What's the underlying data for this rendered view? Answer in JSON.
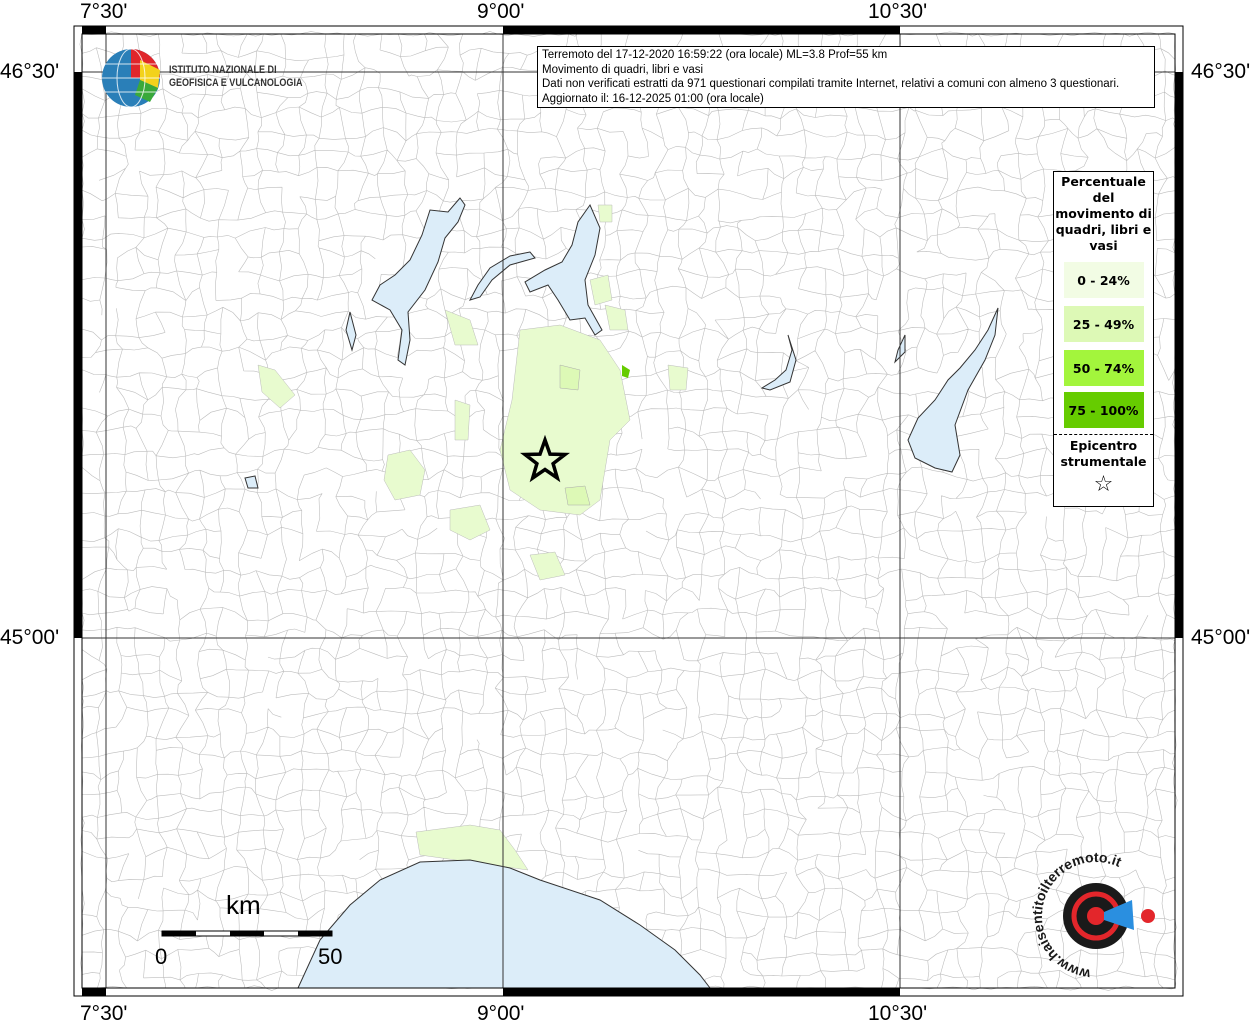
{
  "header": {
    "line1": "Terremoto del 17-12-2020 16:59:22 (ora locale) ML=3.8 Prof=55 km",
    "line2": "Movimento di quadri, libri e vasi",
    "line3": "Dati non verificati estratti da 971 questionari compilati tramite Internet, relativi a comuni con almeno 3 questionari.",
    "line4": "Aggiornato il: 16-12-2025 01:00 (ora locale)"
  },
  "axes": {
    "top": [
      "7°30'",
      "9°00'",
      "10°30'"
    ],
    "bottom": [
      "7°30'",
      "9°00'",
      "10°30'"
    ],
    "left": [
      "46°30'",
      "45°00'"
    ],
    "right": [
      "46°30'",
      "45°00'"
    ]
  },
  "legend": {
    "title": "Percentuale del movimento di quadri, libri e vasi",
    "classes": [
      {
        "label": "0 - 24%",
        "color": "#f2fce4"
      },
      {
        "label": "25 - 49%",
        "color": "#ddf9b6"
      },
      {
        "label": "50 - 74%",
        "color": "#a3f53c"
      },
      {
        "label": "75 - 100%",
        "color": "#66cc00"
      }
    ],
    "epicenter_label": "Epicentro strumentale",
    "epicenter_symbol": "☆"
  },
  "scale": {
    "unit": "km",
    "start": "0",
    "end": "50"
  },
  "logos": {
    "ingv": "ISTITUTO NAZIONALE DI GEOFISICA E VULCANOLOGIA",
    "hsit": "www.haisentitoilterremoto.it"
  },
  "colors": {
    "water": "#dcedf9",
    "boundary": "#bdbdbd"
  }
}
